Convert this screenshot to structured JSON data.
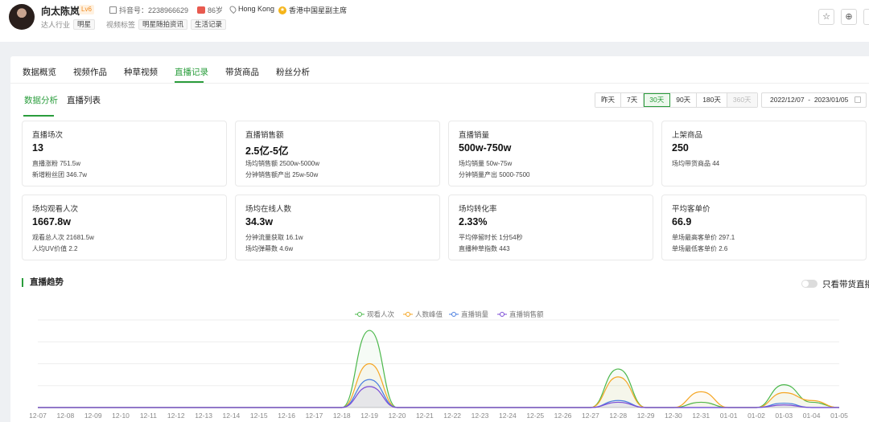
{
  "profile": {
    "name": "向太陈岚",
    "level": "Lv6",
    "douyin_id_label": "抖音号：2238966629",
    "age": "86岁",
    "location": "Hong Kong",
    "title": "香港中国星副主席",
    "industry_label": "达人行业",
    "industry_tag": "明星",
    "video_tags_label": "视频标签",
    "video_tags": [
      "明星随拍资讯",
      "生活记录"
    ]
  },
  "header_buttons": {
    "star": "☆",
    "add": "⊕",
    "more": "⊘"
  },
  "tabs": [
    "数据概览",
    "视频作品",
    "种草视频",
    "直播记录",
    "带货商品",
    "粉丝分析"
  ],
  "active_tab": "直播记录",
  "subtabs": [
    "数据分析",
    "直播列表"
  ],
  "range_buttons": [
    "昨天",
    "7天",
    "30天",
    "90天",
    "180天",
    "360天"
  ],
  "date_range": "2022/12/07  -  2023/01/05",
  "stats": [
    {
      "title": "直播场次",
      "value": "13",
      "line1": "直播涨粉 751.5w",
      "line2": "新增粉丝团 346.7w"
    },
    {
      "title": "直播销售额",
      "value": "2.5亿-5亿",
      "line1": "场均销售额 2500w-5000w",
      "line2": "分钟销售额产出 25w-50w"
    },
    {
      "title": "直播销量",
      "value": "500w-750w",
      "line1": "场均销量 50w-75w",
      "line2": "分钟销量产出 5000-7500"
    },
    {
      "title": "上架商品",
      "value": "250",
      "line1": "场均带货商品 44",
      "line2": ""
    },
    {
      "title": "场均观看人次",
      "value": "1667.8w",
      "line1": "观看总人次 21681.5w",
      "line2": "人均UV价值 2.2"
    },
    {
      "title": "场均在线人数",
      "value": "34.3w",
      "line1": "分钟流量获取 16.1w",
      "line2": "场均弹幕数 4.6w"
    },
    {
      "title": "场均转化率",
      "value": "2.33%",
      "line1": "平均停留时长 1分54秒",
      "line2": "直播种草指数 443"
    },
    {
      "title": "平均客单价",
      "value": "66.9",
      "line1": "单场最高客单价 297.1",
      "line2": "单场最低客单价 2.6"
    }
  ],
  "trend": {
    "title": "直播趋势",
    "toggle_label": "只看带货直播"
  },
  "colors": {
    "accent": "#2a9d3c",
    "s1": "#4cb84c",
    "s2": "#f5a623",
    "s3": "#4a7fe0",
    "s4": "#7b4bd6"
  },
  "chart_data": {
    "type": "line",
    "x": [
      "12-07",
      "12-08",
      "12-09",
      "12-10",
      "12-11",
      "12-12",
      "12-13",
      "12-14",
      "12-15",
      "12-16",
      "12-17",
      "12-18",
      "12-19",
      "12-20",
      "12-21",
      "12-22",
      "12-23",
      "12-24",
      "12-25",
      "12-26",
      "12-27",
      "12-28",
      "12-29",
      "12-30",
      "12-31",
      "01-01",
      "01-02",
      "01-03",
      "01-04",
      "01-05"
    ],
    "series": [
      {
        "name": "观看人次",
        "values": [
          0,
          0,
          0,
          0,
          0,
          0,
          0,
          0,
          0,
          0,
          0,
          0,
          88,
          0,
          0,
          0,
          0,
          0,
          0,
          0,
          0,
          44,
          0,
          0,
          6,
          0,
          0,
          26,
          6,
          0
        ]
      },
      {
        "name": "人数峰值",
        "values": [
          0,
          0,
          0,
          0,
          0,
          0,
          0,
          0,
          0,
          0,
          0,
          0,
          50,
          0,
          0,
          0,
          0,
          0,
          0,
          0,
          0,
          35,
          0,
          0,
          18,
          0,
          0,
          17,
          8,
          0
        ]
      },
      {
        "name": "直播销量",
        "values": [
          0,
          0,
          0,
          0,
          0,
          0,
          0,
          0,
          0,
          0,
          0,
          0,
          32,
          0,
          0,
          0,
          0,
          0,
          0,
          0,
          0,
          8,
          0,
          0,
          0,
          0,
          0,
          5,
          0,
          0
        ]
      },
      {
        "name": "直播销售额",
        "values": [
          0,
          0,
          0,
          0,
          0,
          0,
          0,
          0,
          0,
          0,
          0,
          0,
          24,
          0,
          0,
          0,
          0,
          0,
          0,
          0,
          0,
          6,
          0,
          0,
          0,
          0,
          0,
          3,
          0,
          0
        ]
      }
    ],
    "ylim": [
      0,
      100
    ],
    "grid": true,
    "legend": "top-center"
  }
}
